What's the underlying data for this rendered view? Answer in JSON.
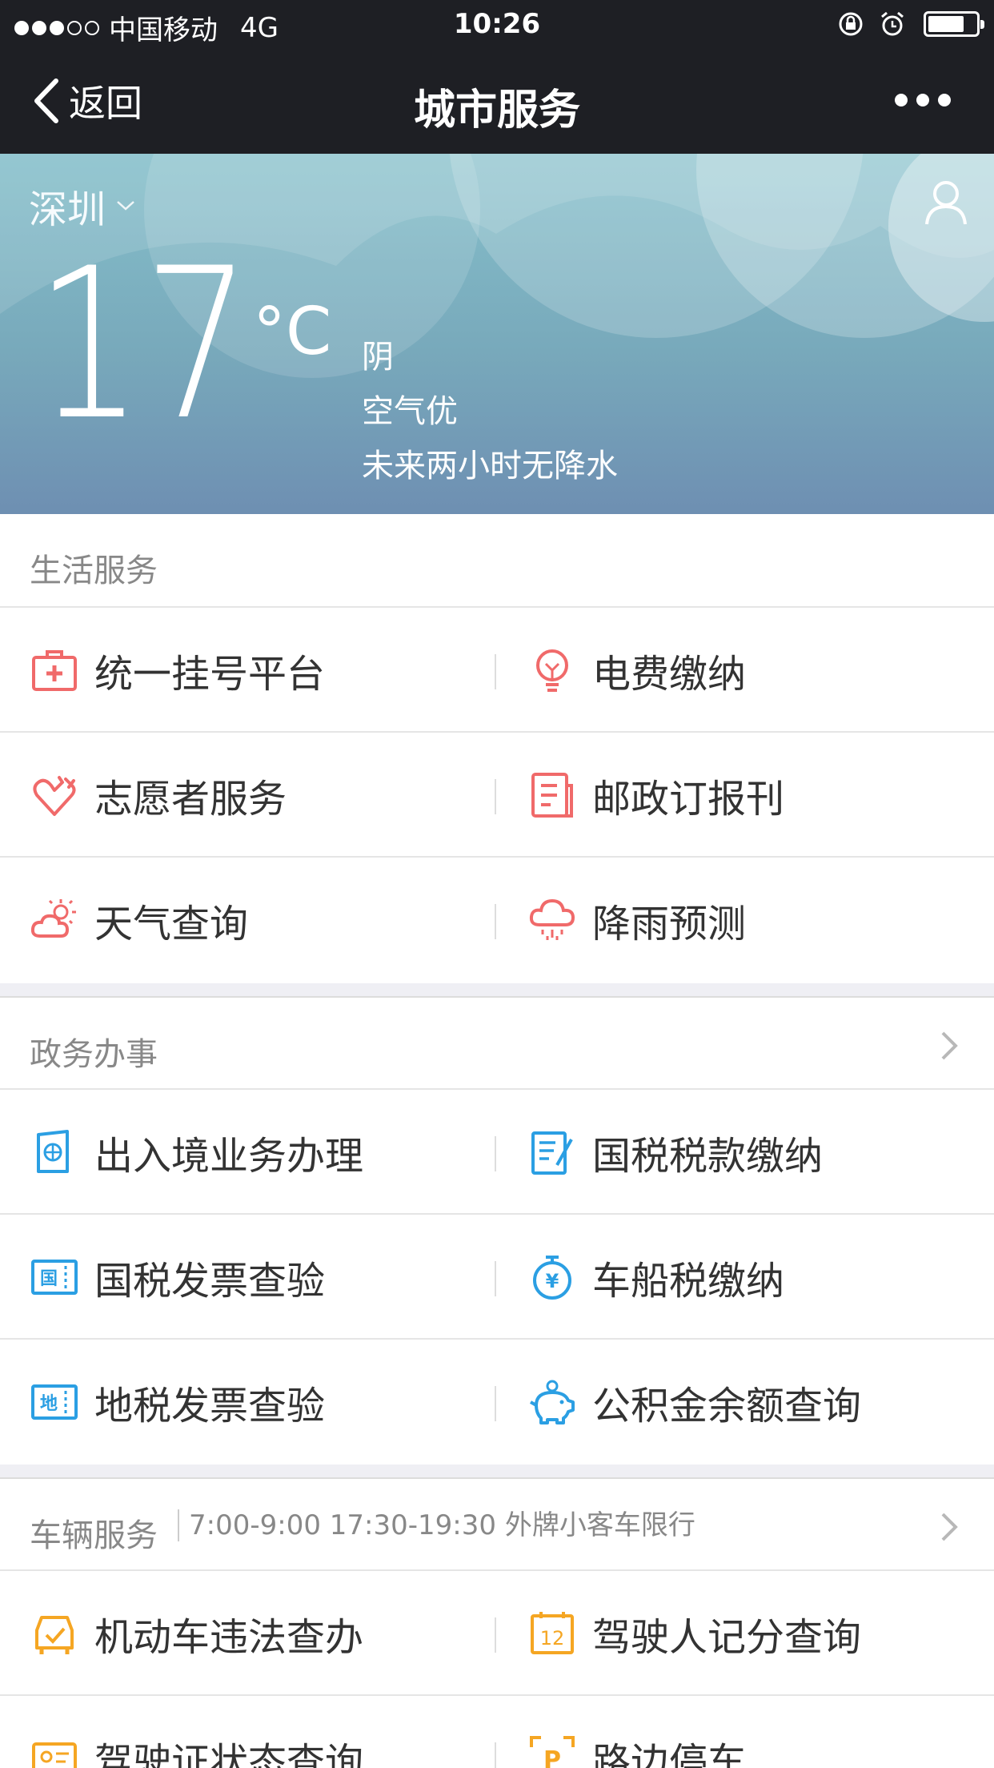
{
  "status_bar": {
    "carrier": "中国移动",
    "network": "4G",
    "time": "10:26",
    "signal_full": 3,
    "signal_total": 5,
    "battery_level": 0.75
  },
  "nav": {
    "back_label": "返回",
    "title": "城市服务"
  },
  "weather": {
    "city": "深圳",
    "temperature": "17",
    "unit": "°C",
    "condition": "阴",
    "air": "空气优",
    "forecast": "未来两小时无降水"
  },
  "sections": [
    {
      "title": "生活服务",
      "items": [
        {
          "label": "统一挂号平台",
          "icon": "medical-kit-icon"
        },
        {
          "label": "电费缴纳",
          "icon": "lightbulb-icon"
        },
        {
          "label": "志愿者服务",
          "icon": "heart-hand-icon"
        },
        {
          "label": "邮政订报刊",
          "icon": "newspaper-icon"
        },
        {
          "label": "天气查询",
          "icon": "sun-cloud-icon"
        },
        {
          "label": "降雨预测",
          "icon": "rain-cloud-icon"
        }
      ]
    },
    {
      "title": "政务办事",
      "items": [
        {
          "label": "出入境业务办理",
          "icon": "passport-icon"
        },
        {
          "label": "国税税款缴纳",
          "icon": "tax-form-icon"
        },
        {
          "label": "国税发票查验",
          "icon": "national-invoice-icon",
          "badge": "国"
        },
        {
          "label": "车船税缴纳",
          "icon": "yuan-timer-icon",
          "badge": "¥"
        },
        {
          "label": "地税发票查验",
          "icon": "local-invoice-icon",
          "badge": "地"
        },
        {
          "label": "公积金余额查询",
          "icon": "piggy-bank-icon"
        }
      ]
    },
    {
      "title": "车辆服务",
      "subtitle": "7:00-9:00 17:30-19:30 外牌小客车限行",
      "items": [
        {
          "label": "机动车违法查办",
          "icon": "car-check-icon"
        },
        {
          "label": "驾驶人记分查询",
          "icon": "calendar-12-icon",
          "badge": "12"
        },
        {
          "label": "驾驶证状态查询",
          "icon": "license-icon"
        },
        {
          "label": "路边停车",
          "icon": "parking-icon",
          "badge": "P"
        }
      ]
    }
  ],
  "colors": {
    "bar": "#1e1f24",
    "life_icon": "#f06a6a",
    "gov_icon": "#2b9fe3",
    "car_icon": "#f5a623"
  }
}
